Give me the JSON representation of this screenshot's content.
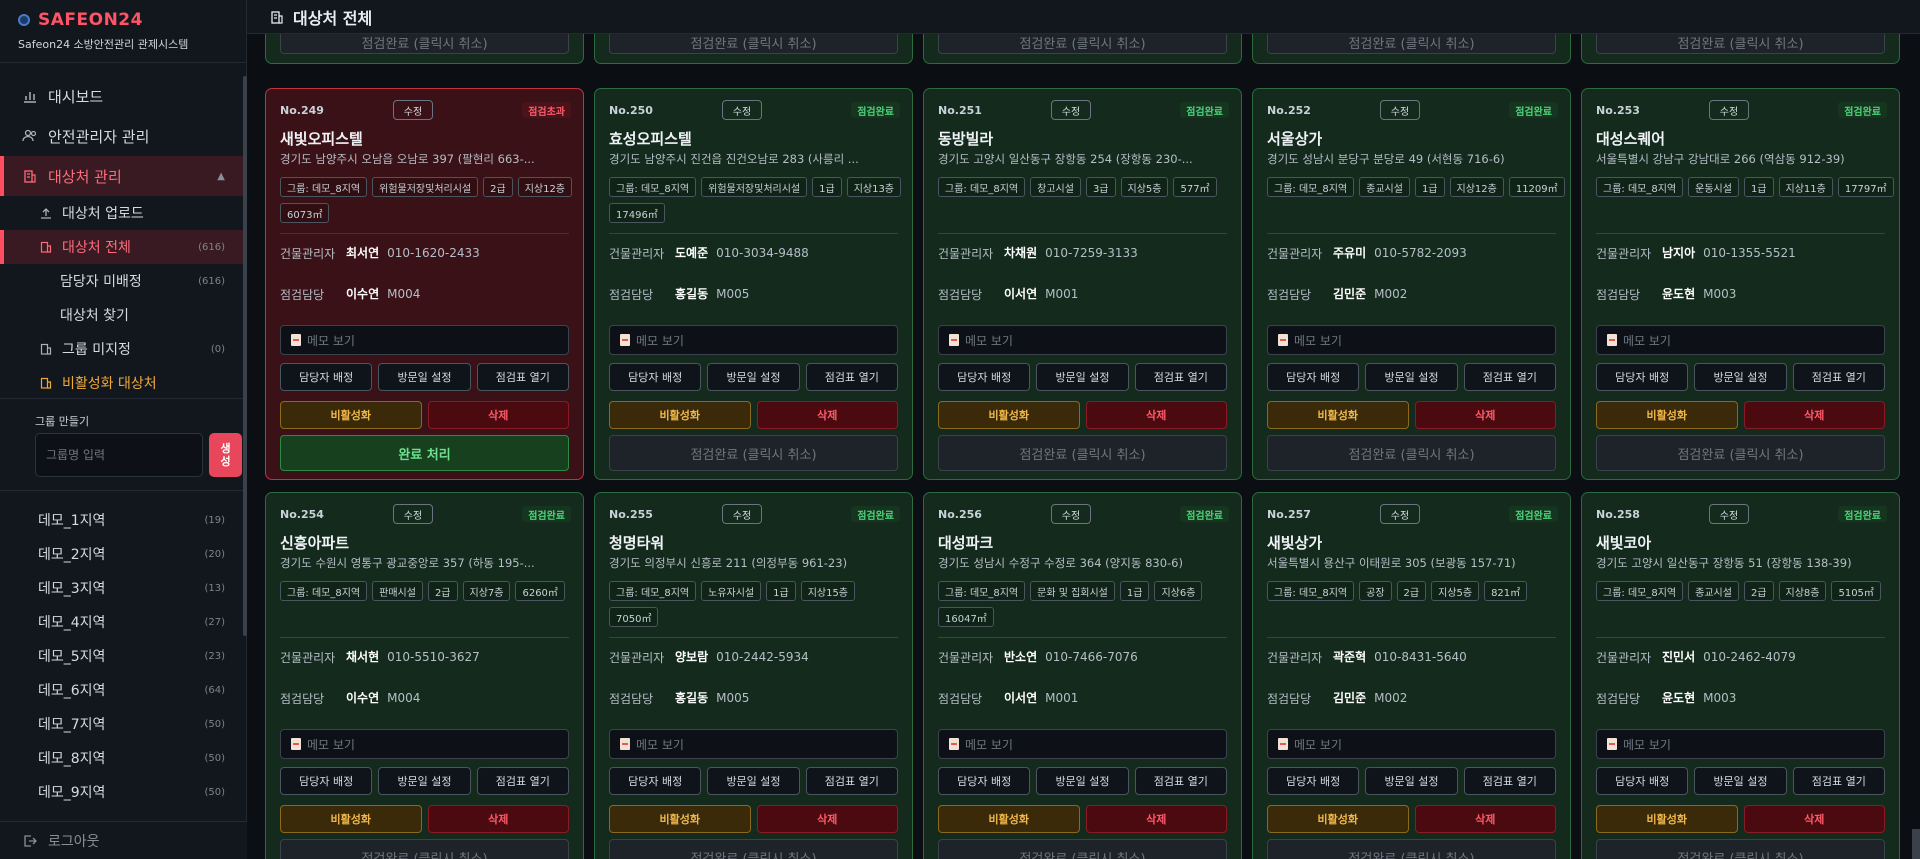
{
  "brand": {
    "title": "SAFEON24",
    "subtitle": "Safeon24 소방안전관리 관제시스템"
  },
  "header": {
    "title": "대상처 전체"
  },
  "nav": {
    "dashboard": "대시보드",
    "manager": "안전관리자 관리",
    "target": "대상처 관리",
    "sub": [
      {
        "label": "대상처 업로드",
        "count": ""
      },
      {
        "label": "대상처 전체",
        "count": "(616)"
      },
      {
        "label": "담당자 미배정",
        "count": "(616)"
      },
      {
        "label": "대상처 찾기",
        "count": ""
      },
      {
        "label": "그룹 미지정",
        "count": "(0)"
      },
      {
        "label": "비활성화 대상처",
        "count": ""
      }
    ]
  },
  "group": {
    "label": "그룹 만들기",
    "placeholder": "그룹명 입력",
    "create": "생성"
  },
  "regions": [
    {
      "label": "데모_1지역",
      "count": "(19)"
    },
    {
      "label": "데모_2지역",
      "count": "(20)"
    },
    {
      "label": "데모_3지역",
      "count": "(13)"
    },
    {
      "label": "데모_4지역",
      "count": "(27)"
    },
    {
      "label": "데모_5지역",
      "count": "(23)"
    },
    {
      "label": "데모_6지역",
      "count": "(64)"
    },
    {
      "label": "데모_7지역",
      "count": "(50)"
    },
    {
      "label": "데모_8지역",
      "count": "(50)"
    },
    {
      "label": "데모_9지역",
      "count": "(50)"
    }
  ],
  "logout": "로그아웃",
  "labels": {
    "edit": "수정",
    "manager": "건물관리자",
    "inspector": "점검담당",
    "memo": "메모 보기",
    "assign": "담당자 배정",
    "visit": "방문일 설정",
    "sheet": "점검표 열기",
    "deactivate": "비활성화",
    "delete": "삭제",
    "cancel_done": "점검완료 (클릭시 취소)",
    "complete": "완료 처리"
  },
  "cards": [
    {
      "no": "No.249",
      "status": "점검초과",
      "name": "새빛오피스텔",
      "addr": "경기도 남양주시 오남읍 오남로 397 (팔현리 663-...",
      "tags": [
        "그룹: 데모_8지역",
        "위험물저장및처리시설",
        "2급",
        "지상12층",
        "6073㎡"
      ],
      "mgr_name": "최서연",
      "mgr_phone": "010-1620-2433",
      "insp_name": "이수연",
      "insp_code": "M004"
    },
    {
      "no": "No.250",
      "status": "점검완료",
      "name": "효성오피스텔",
      "addr": "경기도 남양주시 진건읍 진건오남로 283 (사릉리 ...",
      "tags": [
        "그룹: 데모_8지역",
        "위험물저장및처리시설",
        "1급",
        "지상13층",
        "17496㎡"
      ],
      "mgr_name": "도예준",
      "mgr_phone": "010-3034-9488",
      "insp_name": "홍길동",
      "insp_code": "M005"
    },
    {
      "no": "No.251",
      "status": "점검완료",
      "name": "동방빌라",
      "addr": "경기도 고양시 일산동구 장항동 254 (장항동 230-...",
      "tags": [
        "그룹: 데모_8지역",
        "창고시설",
        "3급",
        "지상5층",
        "577㎡"
      ],
      "mgr_name": "차채원",
      "mgr_phone": "010-7259-3133",
      "insp_name": "이서연",
      "insp_code": "M001"
    },
    {
      "no": "No.252",
      "status": "점검완료",
      "name": "서울상가",
      "addr": "경기도 성남시 분당구 분당로 49 (서현동 716-6)",
      "tags": [
        "그룹: 데모_8지역",
        "종교시설",
        "1급",
        "지상12층",
        "11209㎡"
      ],
      "mgr_name": "주유미",
      "mgr_phone": "010-5782-2093",
      "insp_name": "김민준",
      "insp_code": "M002"
    },
    {
      "no": "No.253",
      "status": "점검완료",
      "name": "대성스퀘어",
      "addr": "서울특별시 강남구 강남대로 266 (역삼동 912-39)",
      "tags": [
        "그룹: 데모_8지역",
        "운동시설",
        "1급",
        "지상11층",
        "17797㎡"
      ],
      "mgr_name": "남지아",
      "mgr_phone": "010-1355-5521",
      "insp_name": "윤도현",
      "insp_code": "M003"
    },
    {
      "no": "No.254",
      "status": "점검완료",
      "name": "신흥아파트",
      "addr": "경기도 수원시 영통구 광교중앙로 357 (하동 195-...",
      "tags": [
        "그룹: 데모_8지역",
        "판매시설",
        "2급",
        "지상7층",
        "6260㎡"
      ],
      "mgr_name": "채서현",
      "mgr_phone": "010-5510-3627",
      "insp_name": "이수연",
      "insp_code": "M004"
    },
    {
      "no": "No.255",
      "status": "점검완료",
      "name": "청명타워",
      "addr": "경기도 의정부시 신흥로 211 (의정부동 961-23)",
      "tags": [
        "그룹: 데모_8지역",
        "노유자시설",
        "1급",
        "지상15층",
        "7050㎡"
      ],
      "mgr_name": "양보람",
      "mgr_phone": "010-2442-5934",
      "insp_name": "홍길동",
      "insp_code": "M005"
    },
    {
      "no": "No.256",
      "status": "점검완료",
      "name": "대성파크",
      "addr": "경기도 성남시 수정구 수정로 364 (양지동 830-6)",
      "tags": [
        "그룹: 데모_8지역",
        "문화 및 집회시설",
        "1급",
        "지상6층",
        "16047㎡"
      ],
      "mgr_name": "반소연",
      "mgr_phone": "010-7466-7076",
      "insp_name": "이서연",
      "insp_code": "M001"
    },
    {
      "no": "No.257",
      "status": "점검완료",
      "name": "새빛상가",
      "addr": "서울특별시 용산구 이태원로 305 (보광동 157-71)",
      "tags": [
        "그룹: 데모_8지역",
        "공장",
        "2급",
        "지상5층",
        "821㎡"
      ],
      "mgr_name": "곽준혁",
      "mgr_phone": "010-8431-5640",
      "insp_name": "김민준",
      "insp_code": "M002"
    },
    {
      "no": "No.258",
      "status": "점검완료",
      "name": "새빛코아",
      "addr": "경기도 고양시 일산동구 장항동 51 (장항동 138-39)",
      "tags": [
        "그룹: 데모_8지역",
        "종교시설",
        "2급",
        "지상8층",
        "5105㎡"
      ],
      "mgr_name": "진민서",
      "mgr_phone": "010-2462-4079",
      "insp_name": "윤도현",
      "insp_code": "M003"
    }
  ]
}
